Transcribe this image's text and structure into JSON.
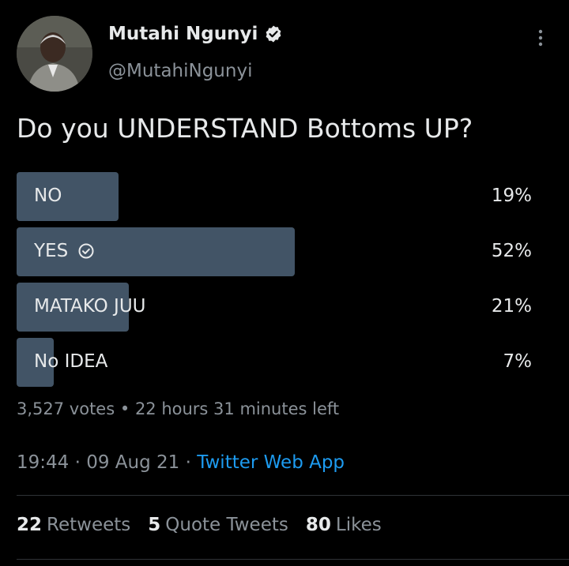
{
  "tweet": {
    "author_name": "Mutahi Ngunyi",
    "author_handle": "@MutahiNgunyi",
    "question": "Do you UNDERSTAND Bottoms UP?"
  },
  "poll": {
    "options": [
      {
        "label": "NO",
        "percent_text": "19%",
        "fraction": 0.19,
        "selected": false
      },
      {
        "label": "YES",
        "percent_text": "52%",
        "fraction": 0.52,
        "selected": true
      },
      {
        "label": "MATAKO JUU",
        "percent_text": "21%",
        "fraction": 0.21,
        "selected": false
      },
      {
        "label": "No IDEA",
        "percent_text": "7%",
        "fraction": 0.07,
        "selected": false
      }
    ],
    "votes": "3,527 votes",
    "separator": "•",
    "time_left": "22 hours 31 minutes left"
  },
  "meta": {
    "time": "19:44",
    "date": "09 Aug 21",
    "dot": "·",
    "source": "Twitter Web App"
  },
  "stats": {
    "retweets_count": "22",
    "retweets_label": "Retweets",
    "quotes_count": "5",
    "quotes_label": "Quote Tweets",
    "likes_count": "80",
    "likes_label": "Likes"
  },
  "colors": {
    "poll_bar": "#425466",
    "link": "#1d9bf0",
    "secondary_text": "#8b9299",
    "verified_badge": "#e7e9ea"
  },
  "icons": {
    "verified": "verified-badge-icon",
    "more": "more-vertical-icon",
    "selected": "check-circle-icon"
  }
}
